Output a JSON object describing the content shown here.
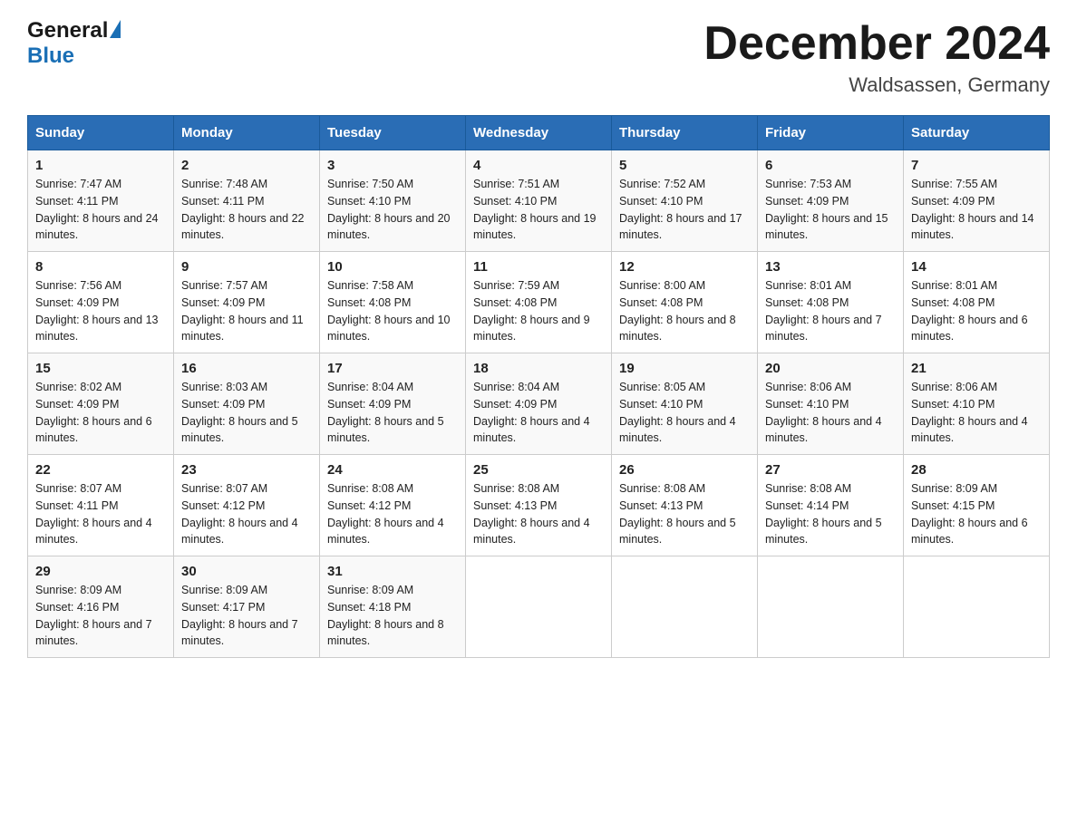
{
  "logo": {
    "general": "General",
    "blue": "Blue"
  },
  "title": "December 2024",
  "location": "Waldsassen, Germany",
  "days_of_week": [
    "Sunday",
    "Monday",
    "Tuesday",
    "Wednesday",
    "Thursday",
    "Friday",
    "Saturday"
  ],
  "weeks": [
    [
      {
        "day": "1",
        "sunrise": "7:47 AM",
        "sunset": "4:11 PM",
        "daylight": "8 hours and 24 minutes."
      },
      {
        "day": "2",
        "sunrise": "7:48 AM",
        "sunset": "4:11 PM",
        "daylight": "8 hours and 22 minutes."
      },
      {
        "day": "3",
        "sunrise": "7:50 AM",
        "sunset": "4:10 PM",
        "daylight": "8 hours and 20 minutes."
      },
      {
        "day": "4",
        "sunrise": "7:51 AM",
        "sunset": "4:10 PM",
        "daylight": "8 hours and 19 minutes."
      },
      {
        "day": "5",
        "sunrise": "7:52 AM",
        "sunset": "4:10 PM",
        "daylight": "8 hours and 17 minutes."
      },
      {
        "day": "6",
        "sunrise": "7:53 AM",
        "sunset": "4:09 PM",
        "daylight": "8 hours and 15 minutes."
      },
      {
        "day": "7",
        "sunrise": "7:55 AM",
        "sunset": "4:09 PM",
        "daylight": "8 hours and 14 minutes."
      }
    ],
    [
      {
        "day": "8",
        "sunrise": "7:56 AM",
        "sunset": "4:09 PM",
        "daylight": "8 hours and 13 minutes."
      },
      {
        "day": "9",
        "sunrise": "7:57 AM",
        "sunset": "4:09 PM",
        "daylight": "8 hours and 11 minutes."
      },
      {
        "day": "10",
        "sunrise": "7:58 AM",
        "sunset": "4:08 PM",
        "daylight": "8 hours and 10 minutes."
      },
      {
        "day": "11",
        "sunrise": "7:59 AM",
        "sunset": "4:08 PM",
        "daylight": "8 hours and 9 minutes."
      },
      {
        "day": "12",
        "sunrise": "8:00 AM",
        "sunset": "4:08 PM",
        "daylight": "8 hours and 8 minutes."
      },
      {
        "day": "13",
        "sunrise": "8:01 AM",
        "sunset": "4:08 PM",
        "daylight": "8 hours and 7 minutes."
      },
      {
        "day": "14",
        "sunrise": "8:01 AM",
        "sunset": "4:08 PM",
        "daylight": "8 hours and 6 minutes."
      }
    ],
    [
      {
        "day": "15",
        "sunrise": "8:02 AM",
        "sunset": "4:09 PM",
        "daylight": "8 hours and 6 minutes."
      },
      {
        "day": "16",
        "sunrise": "8:03 AM",
        "sunset": "4:09 PM",
        "daylight": "8 hours and 5 minutes."
      },
      {
        "day": "17",
        "sunrise": "8:04 AM",
        "sunset": "4:09 PM",
        "daylight": "8 hours and 5 minutes."
      },
      {
        "day": "18",
        "sunrise": "8:04 AM",
        "sunset": "4:09 PM",
        "daylight": "8 hours and 4 minutes."
      },
      {
        "day": "19",
        "sunrise": "8:05 AM",
        "sunset": "4:10 PM",
        "daylight": "8 hours and 4 minutes."
      },
      {
        "day": "20",
        "sunrise": "8:06 AM",
        "sunset": "4:10 PM",
        "daylight": "8 hours and 4 minutes."
      },
      {
        "day": "21",
        "sunrise": "8:06 AM",
        "sunset": "4:10 PM",
        "daylight": "8 hours and 4 minutes."
      }
    ],
    [
      {
        "day": "22",
        "sunrise": "8:07 AM",
        "sunset": "4:11 PM",
        "daylight": "8 hours and 4 minutes."
      },
      {
        "day": "23",
        "sunrise": "8:07 AM",
        "sunset": "4:12 PM",
        "daylight": "8 hours and 4 minutes."
      },
      {
        "day": "24",
        "sunrise": "8:08 AM",
        "sunset": "4:12 PM",
        "daylight": "8 hours and 4 minutes."
      },
      {
        "day": "25",
        "sunrise": "8:08 AM",
        "sunset": "4:13 PM",
        "daylight": "8 hours and 4 minutes."
      },
      {
        "day": "26",
        "sunrise": "8:08 AM",
        "sunset": "4:13 PM",
        "daylight": "8 hours and 5 minutes."
      },
      {
        "day": "27",
        "sunrise": "8:08 AM",
        "sunset": "4:14 PM",
        "daylight": "8 hours and 5 minutes."
      },
      {
        "day": "28",
        "sunrise": "8:09 AM",
        "sunset": "4:15 PM",
        "daylight": "8 hours and 6 minutes."
      }
    ],
    [
      {
        "day": "29",
        "sunrise": "8:09 AM",
        "sunset": "4:16 PM",
        "daylight": "8 hours and 7 minutes."
      },
      {
        "day": "30",
        "sunrise": "8:09 AM",
        "sunset": "4:17 PM",
        "daylight": "8 hours and 7 minutes."
      },
      {
        "day": "31",
        "sunrise": "8:09 AM",
        "sunset": "4:18 PM",
        "daylight": "8 hours and 8 minutes."
      },
      null,
      null,
      null,
      null
    ]
  ]
}
